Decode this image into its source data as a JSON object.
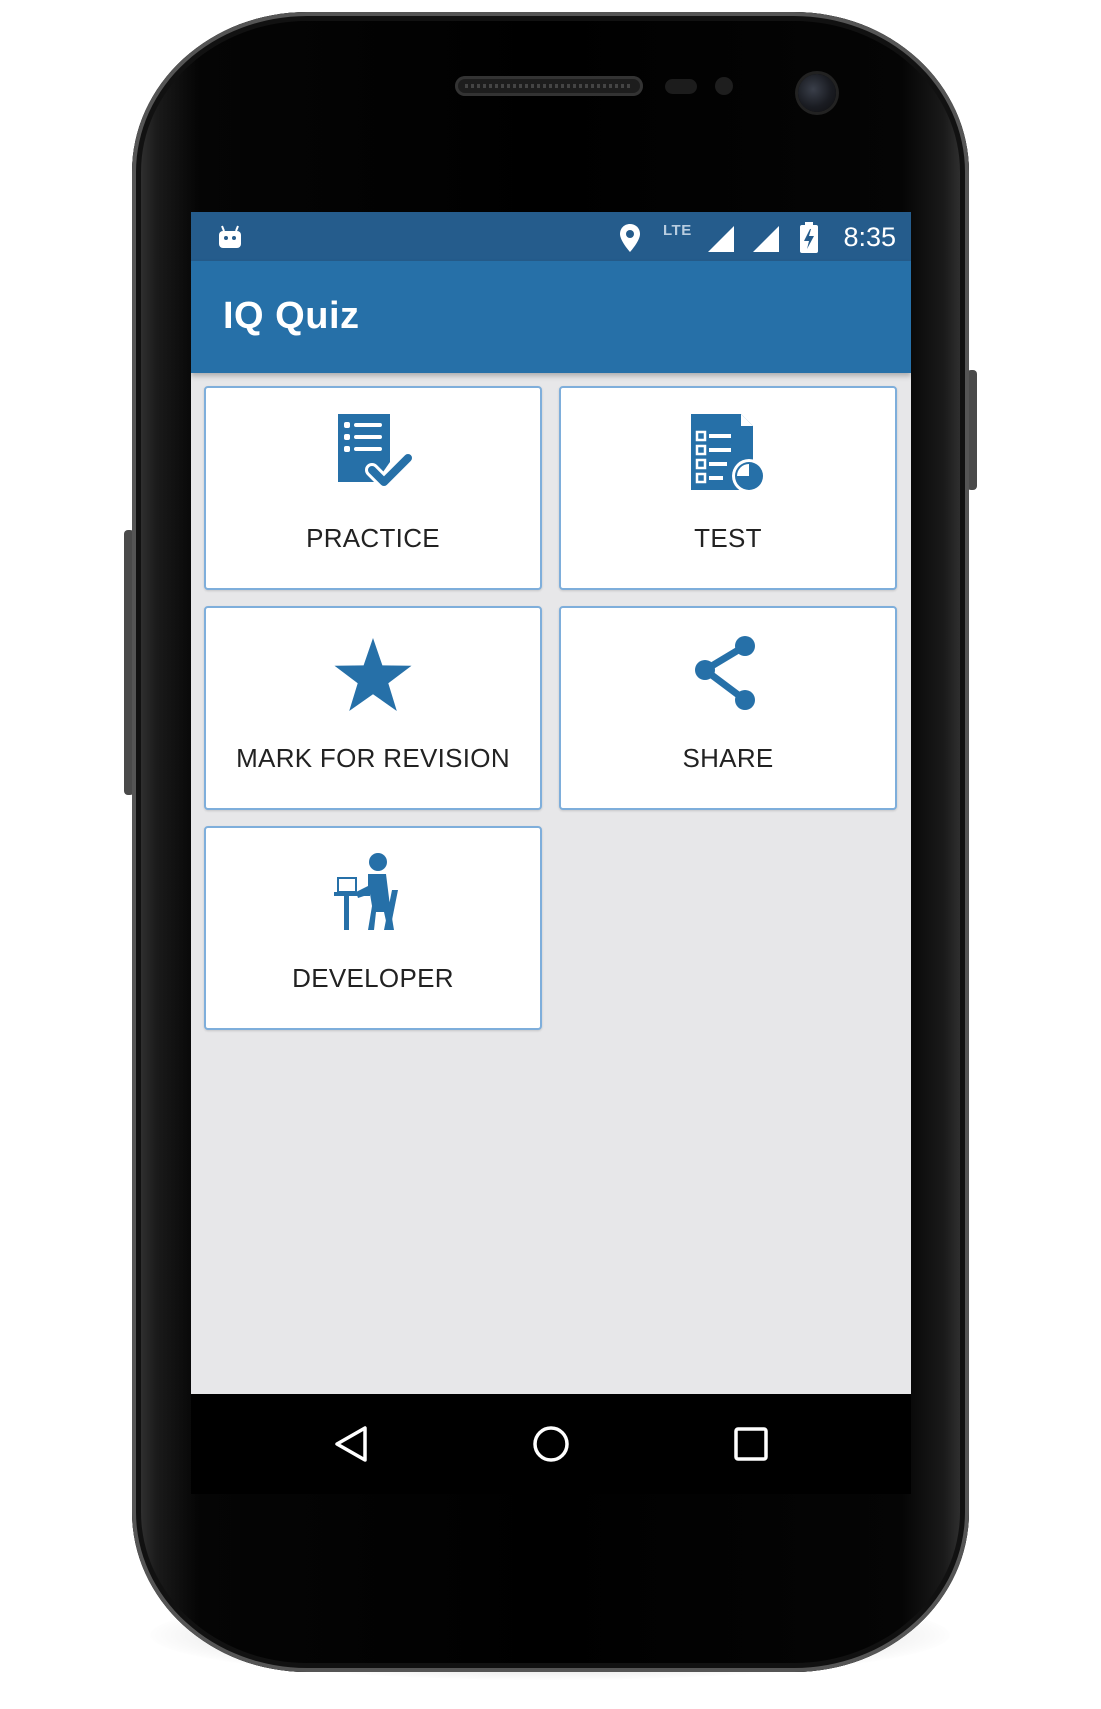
{
  "status_bar": {
    "network_label": "LTE",
    "time": "8:35"
  },
  "app_bar": {
    "title": "IQ Quiz"
  },
  "menu": [
    {
      "label": "PRACTICE",
      "icon": "checklist-icon"
    },
    {
      "label": "TEST",
      "icon": "test-document-icon"
    },
    {
      "label": "MARK FOR REVISION",
      "icon": "star-icon"
    },
    {
      "label": "SHARE",
      "icon": "share-icon"
    },
    {
      "label": "DEVELOPER",
      "icon": "developer-icon"
    }
  ],
  "nav_bar": {
    "buttons": [
      "back-icon",
      "home-icon",
      "recent-apps-icon"
    ]
  },
  "colors": {
    "status_bar": "#255c8c",
    "app_bar": "#2670a8",
    "accent": "#2670a8",
    "card_border": "#7eaedb",
    "background": "#e7e7e9"
  }
}
